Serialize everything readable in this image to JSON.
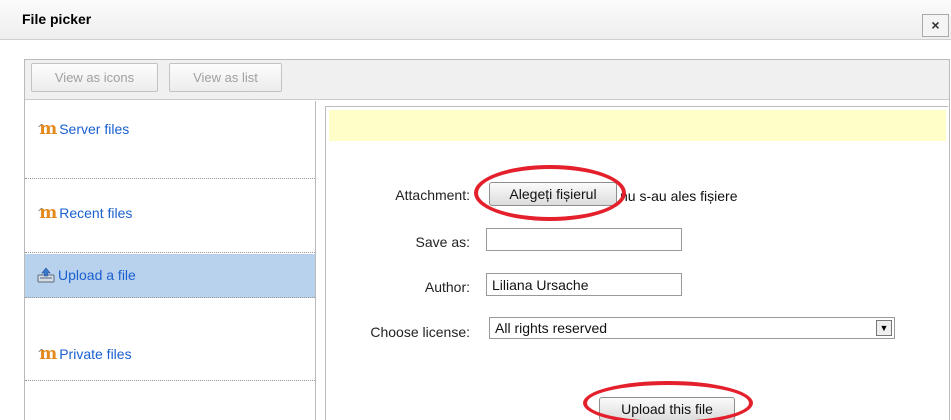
{
  "dialog": {
    "title": "File picker",
    "close_label": "×"
  },
  "toolbar": {
    "view_icons_label": "View as icons",
    "view_list_label": "View as list"
  },
  "sidebar": {
    "items": [
      {
        "label": "Server files",
        "icon": "moodle-icon"
      },
      {
        "label": "Recent files",
        "icon": "moodle-icon"
      },
      {
        "label": "Upload a file",
        "icon": "upload-icon",
        "active": true
      },
      {
        "label": "Private files",
        "icon": "moodle-icon"
      }
    ]
  },
  "form": {
    "attachment_label": "Attachment:",
    "choose_file_label": "Alegeți fișierul",
    "file_status": "nu s-au ales fișiere",
    "save_as_label": "Save as:",
    "save_as_value": "",
    "author_label": "Author:",
    "author_value": "Liliana Ursache",
    "license_label": "Choose license:",
    "license_value": "All rights reserved",
    "upload_label": "Upload this file"
  },
  "colors": {
    "link": "#1a5fd0",
    "active_item": "#b8d1ec",
    "message_bar": "#fffdc8",
    "annotation": "#e3202b"
  }
}
